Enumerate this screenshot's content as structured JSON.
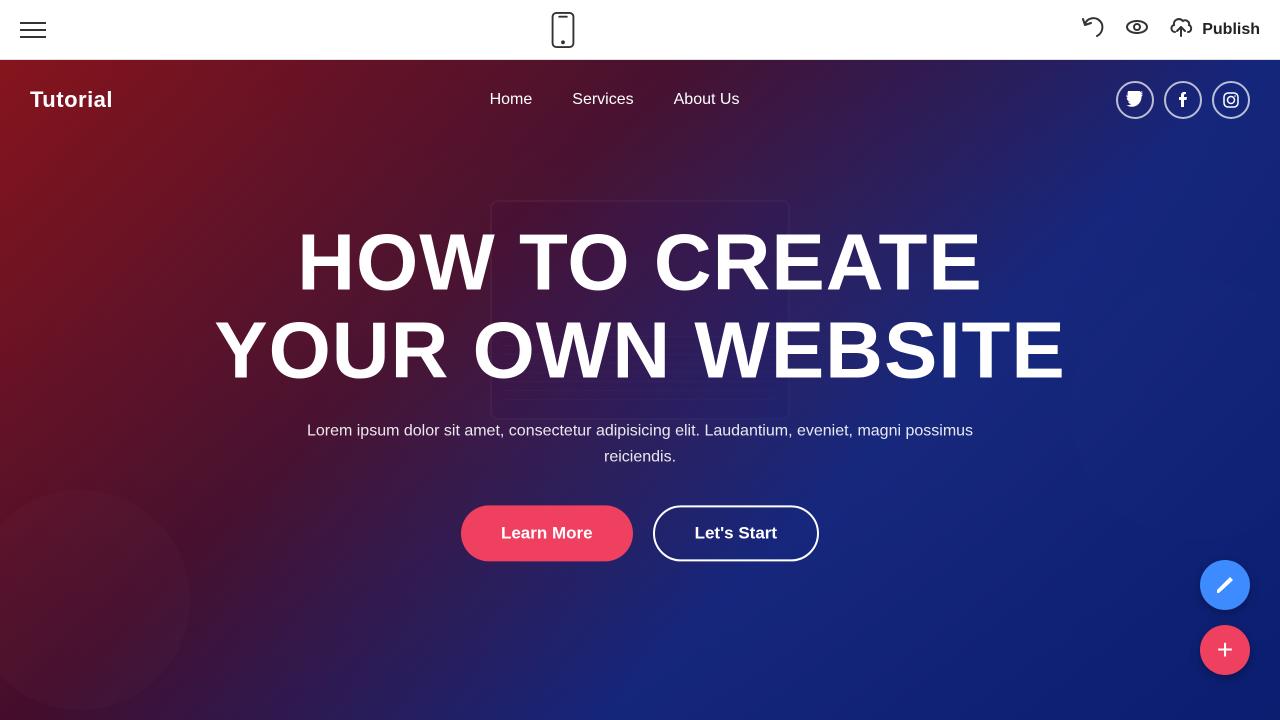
{
  "toolbar": {
    "hamburger_label": "menu",
    "undo_label": "undo",
    "preview_label": "preview",
    "publish_icon_label": "publish-cloud-icon",
    "publish_label": "Publish"
  },
  "site": {
    "nav": {
      "logo": "Tutorial",
      "links": [
        {
          "label": "Home",
          "id": "home"
        },
        {
          "label": "Services",
          "id": "services"
        },
        {
          "label": "About Us",
          "id": "about"
        }
      ],
      "socials": [
        {
          "label": "Twitter",
          "icon": "𝕏",
          "id": "twitter"
        },
        {
          "label": "Facebook",
          "icon": "f",
          "id": "facebook"
        },
        {
          "label": "Instagram",
          "icon": "◎",
          "id": "instagram"
        }
      ]
    },
    "hero": {
      "title_line1": "HOW TO CREATE",
      "title_line2": "YOUR OWN WEBSITE",
      "subtitle": "Lorem ipsum dolor sit amet, consectetur adipisicing elit. Laudantium, eveniet, magni possimus reiciendis.",
      "btn_learn_more": "Learn More",
      "btn_lets_start": "Let's Start"
    }
  },
  "fab": {
    "edit_icon": "pencil",
    "add_icon": "+"
  }
}
